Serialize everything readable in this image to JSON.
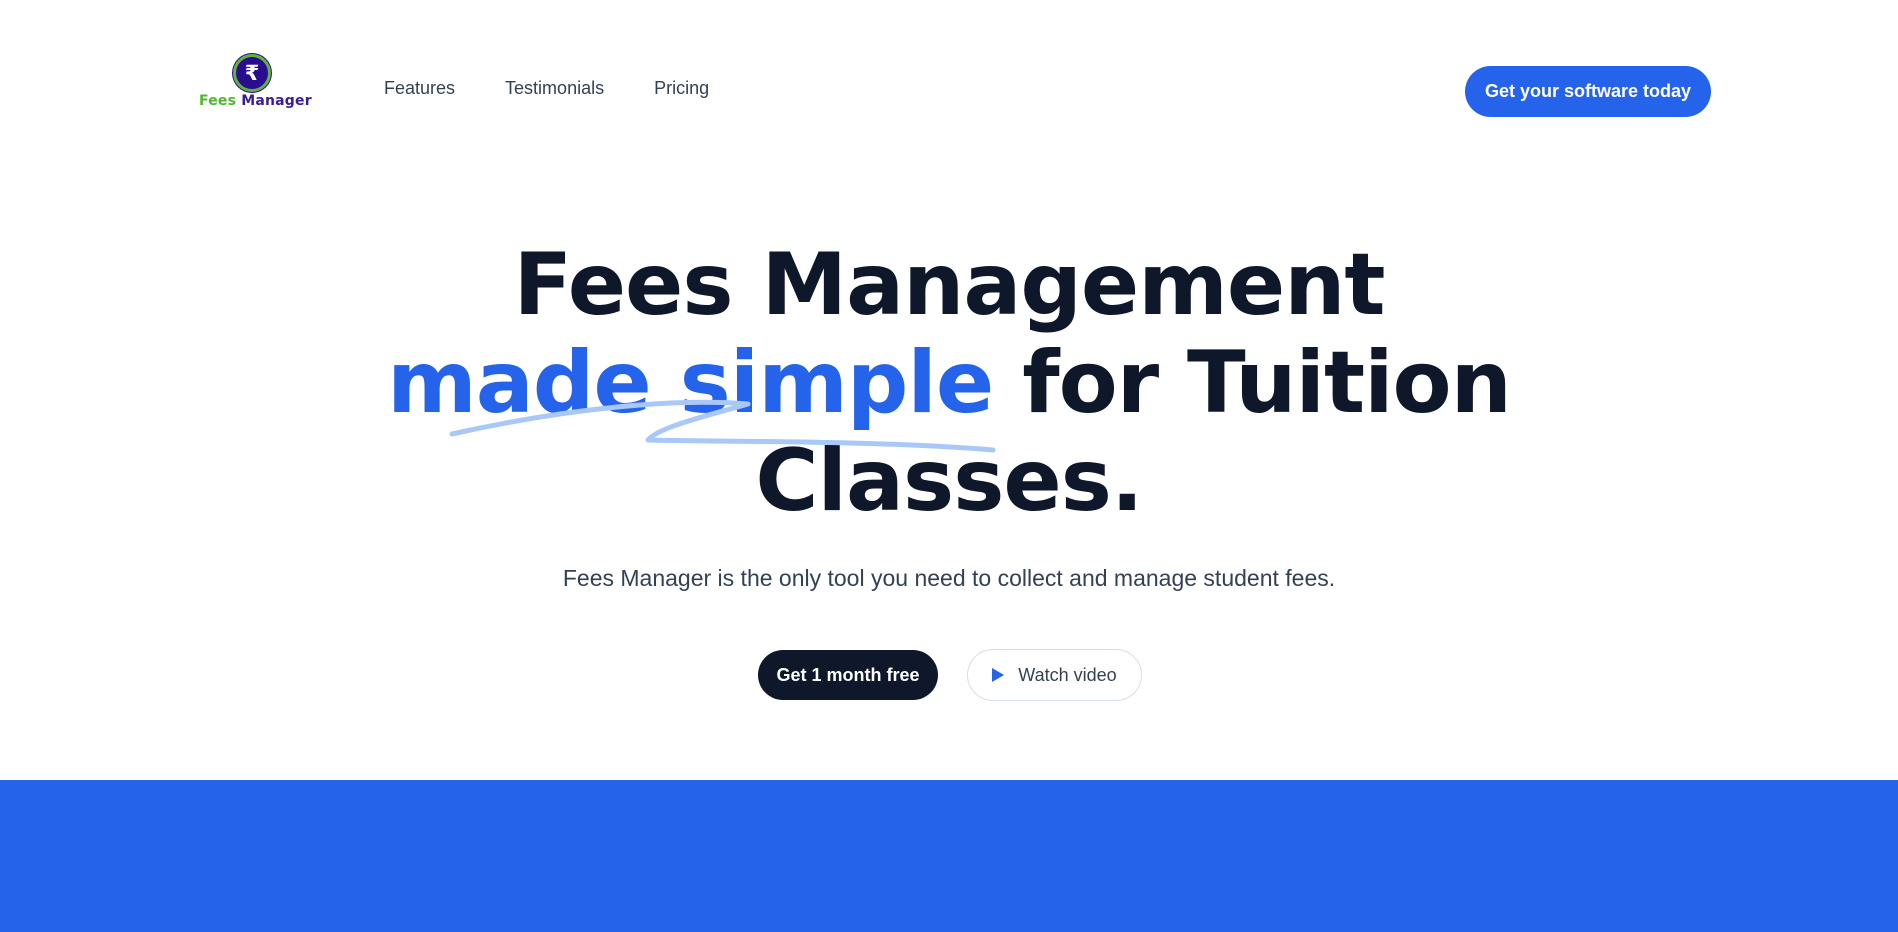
{
  "brand": {
    "symbol": "₹",
    "name_part1": "Fees",
    "name_part2": "Manager",
    "colors": {
      "primary": "#2563eb",
      "dark": "#0f172a",
      "logo_purple": "#2a0d8f",
      "logo_green": "#52b52e"
    }
  },
  "nav": {
    "items": [
      {
        "label": "Features"
      },
      {
        "label": "Testimonials"
      },
      {
        "label": "Pricing"
      }
    ],
    "cta_label": "Get your software today"
  },
  "hero": {
    "title_line1": "Fees Management",
    "title_accent": "made simple",
    "title_line2_rest": " for Tuition",
    "title_line3": "Classes.",
    "subtitle": "Fees Manager is the only tool you need to collect and manage student fees.",
    "primary_cta": "Get 1 month free",
    "secondary_cta": "Watch video",
    "secondary_icon": "play-icon"
  }
}
